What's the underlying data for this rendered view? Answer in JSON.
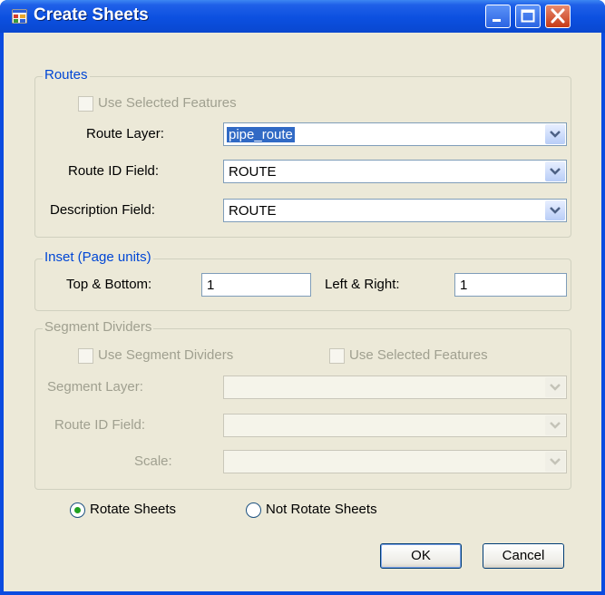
{
  "window": {
    "title": "Create Sheets"
  },
  "routes": {
    "legend": "Routes",
    "use_selected_label": "Use Selected Features",
    "route_layer_label": "Route Layer:",
    "route_layer_value": "pipe_route",
    "route_id_label": "Route ID Field:",
    "route_id_value": "ROUTE",
    "description_label": "Description Field:",
    "description_value": "ROUTE"
  },
  "inset": {
    "legend": "Inset (Page units)",
    "top_bottom_label": "Top & Bottom:",
    "top_bottom_value": "1",
    "left_right_label": "Left & Right:",
    "left_right_value": "1"
  },
  "segments": {
    "legend": "Segment Dividers",
    "use_dividers_label": "Use Segment Dividers",
    "use_selected_label": "Use Selected Features",
    "segment_layer_label": "Segment Layer:",
    "route_id_label": "Route ID Field:",
    "scale_label": "Scale:"
  },
  "rotation": {
    "rotate_label": "Rotate Sheets",
    "not_rotate_label": "Not Rotate Sheets",
    "selected": "rotate"
  },
  "buttons": {
    "ok": "OK",
    "cancel": "Cancel"
  },
  "colors": {
    "title_bar": "#0c50e0",
    "group_legend": "#0046d5",
    "disabled_text": "#a0a090",
    "dialog_bg": "#ece9d8"
  }
}
